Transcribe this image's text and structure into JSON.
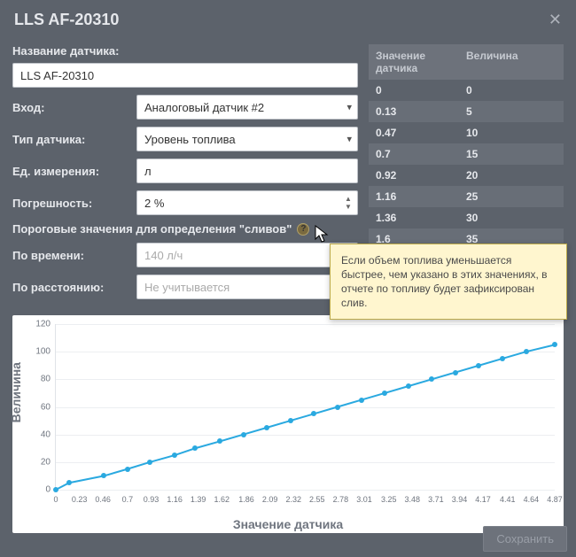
{
  "title": "LLS AF-20310",
  "form": {
    "name_label": "Название датчика:",
    "name_value": "LLS AF-20310",
    "input_label": "Вход:",
    "input_value": "Аналоговый датчик #2",
    "type_label": "Тип датчика:",
    "type_value": "Уровень топлива",
    "unit_label": "Ед. измерения:",
    "unit_value": "л",
    "error_label": "Погрешность:",
    "error_value": "2 %",
    "thresholds_label": "Пороговые значения для определения \"сливов\"",
    "by_time_label": "По времени:",
    "by_time_placeholder": "140 л/ч",
    "by_dist_label": "По расстоянию:",
    "by_dist_placeholder": "Не учитывается"
  },
  "tooltip": "Если объем топлива уменьшается быстрее, чем указано в этих значениях, в отчете по топливу будет зафиксирован слив.",
  "table": {
    "head_sensor": "Значение датчика",
    "head_value": "Величина",
    "rows": [
      {
        "sensor": "0",
        "value": "0"
      },
      {
        "sensor": "0.13",
        "value": "5"
      },
      {
        "sensor": "0.47",
        "value": "10"
      },
      {
        "sensor": "0.7",
        "value": "15"
      },
      {
        "sensor": "0.92",
        "value": "20"
      },
      {
        "sensor": "1.16",
        "value": "25"
      },
      {
        "sensor": "1.36",
        "value": "30"
      },
      {
        "sensor": "1.6",
        "value": "35"
      }
    ]
  },
  "chart_data": {
    "type": "line",
    "xlabel": "Значение датчика",
    "ylabel": "Величина",
    "xlim": [
      0,
      4.87
    ],
    "ylim": [
      0,
      120
    ],
    "yticks": [
      0,
      20,
      40,
      60,
      80,
      100,
      120
    ],
    "xticks": [
      0,
      0.23,
      0.46,
      0.7,
      0.93,
      1.16,
      1.39,
      1.62,
      1.86,
      2.09,
      2.32,
      2.55,
      2.78,
      3.01,
      3.25,
      3.48,
      3.71,
      3.94,
      4.17,
      4.41,
      4.64,
      4.87
    ],
    "x": [
      0,
      0.13,
      0.47,
      0.7,
      0.92,
      1.16,
      1.36,
      1.6,
      1.83,
      2.06,
      2.29,
      2.52,
      2.75,
      2.98,
      3.21,
      3.44,
      3.67,
      3.9,
      4.13,
      4.36,
      4.59,
      4.87
    ],
    "y": [
      0,
      5,
      10,
      15,
      20,
      25,
      30,
      35,
      40,
      45,
      50,
      55,
      60,
      65,
      70,
      75,
      80,
      85,
      90,
      95,
      100,
      105
    ]
  },
  "footer": {
    "save": "Сохранить"
  }
}
